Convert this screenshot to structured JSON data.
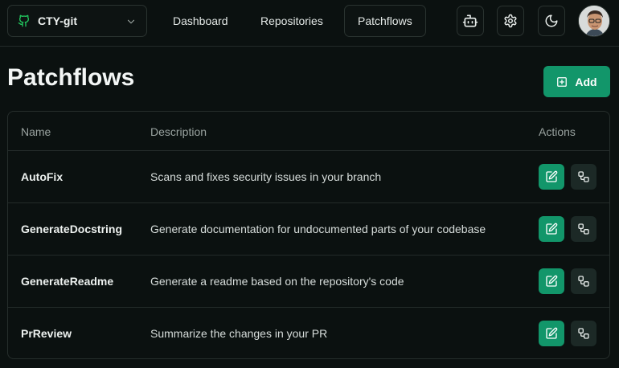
{
  "org": {
    "name": "CTY-git",
    "icon": "github-icon"
  },
  "nav": {
    "dashboard": "Dashboard",
    "repositories": "Repositories",
    "patchflows": "Patchflows"
  },
  "page": {
    "title": "Patchflows",
    "add_label": "Add"
  },
  "table": {
    "headers": {
      "name": "Name",
      "description": "Description",
      "actions": "Actions"
    },
    "rows": [
      {
        "name": "AutoFix",
        "description": "Scans and fixes security issues in your branch"
      },
      {
        "name": "GenerateDocstring",
        "description": "Generate documentation for undocumented parts of your codebase"
      },
      {
        "name": "GenerateReadme",
        "description": "Generate a readme based on the repository's code"
      },
      {
        "name": "PrReview",
        "description": "Summarize the changes in your PR"
      }
    ]
  },
  "colors": {
    "accent": "#12966a",
    "background": "#0b1110",
    "border": "#262e2c"
  }
}
